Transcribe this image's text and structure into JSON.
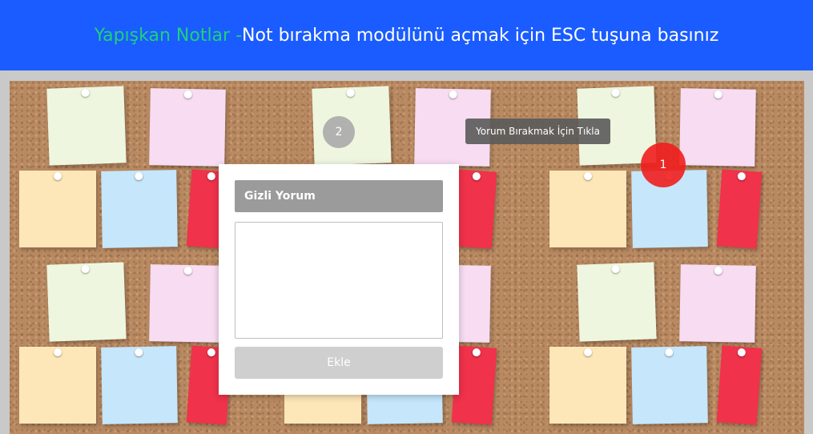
{
  "header": {
    "accent_text": "Yapışkan Notlar -",
    "main_text": "Not bırakma modülünü açmak için ESC tuşuna basınız"
  },
  "tooltip": {
    "text": "Yorum Bırakmak İçin Tıkla"
  },
  "markers": {
    "marker_2": "2",
    "marker_1": "1"
  },
  "modal": {
    "title": "Gizli Yorum",
    "textarea_value": "",
    "button_label": "Ekle"
  },
  "colors": {
    "header_bg": "#1a5cff",
    "accent_green": "#1fd17a",
    "marker_red": "#f0201e",
    "marker_gray": "#aaaaaa"
  }
}
